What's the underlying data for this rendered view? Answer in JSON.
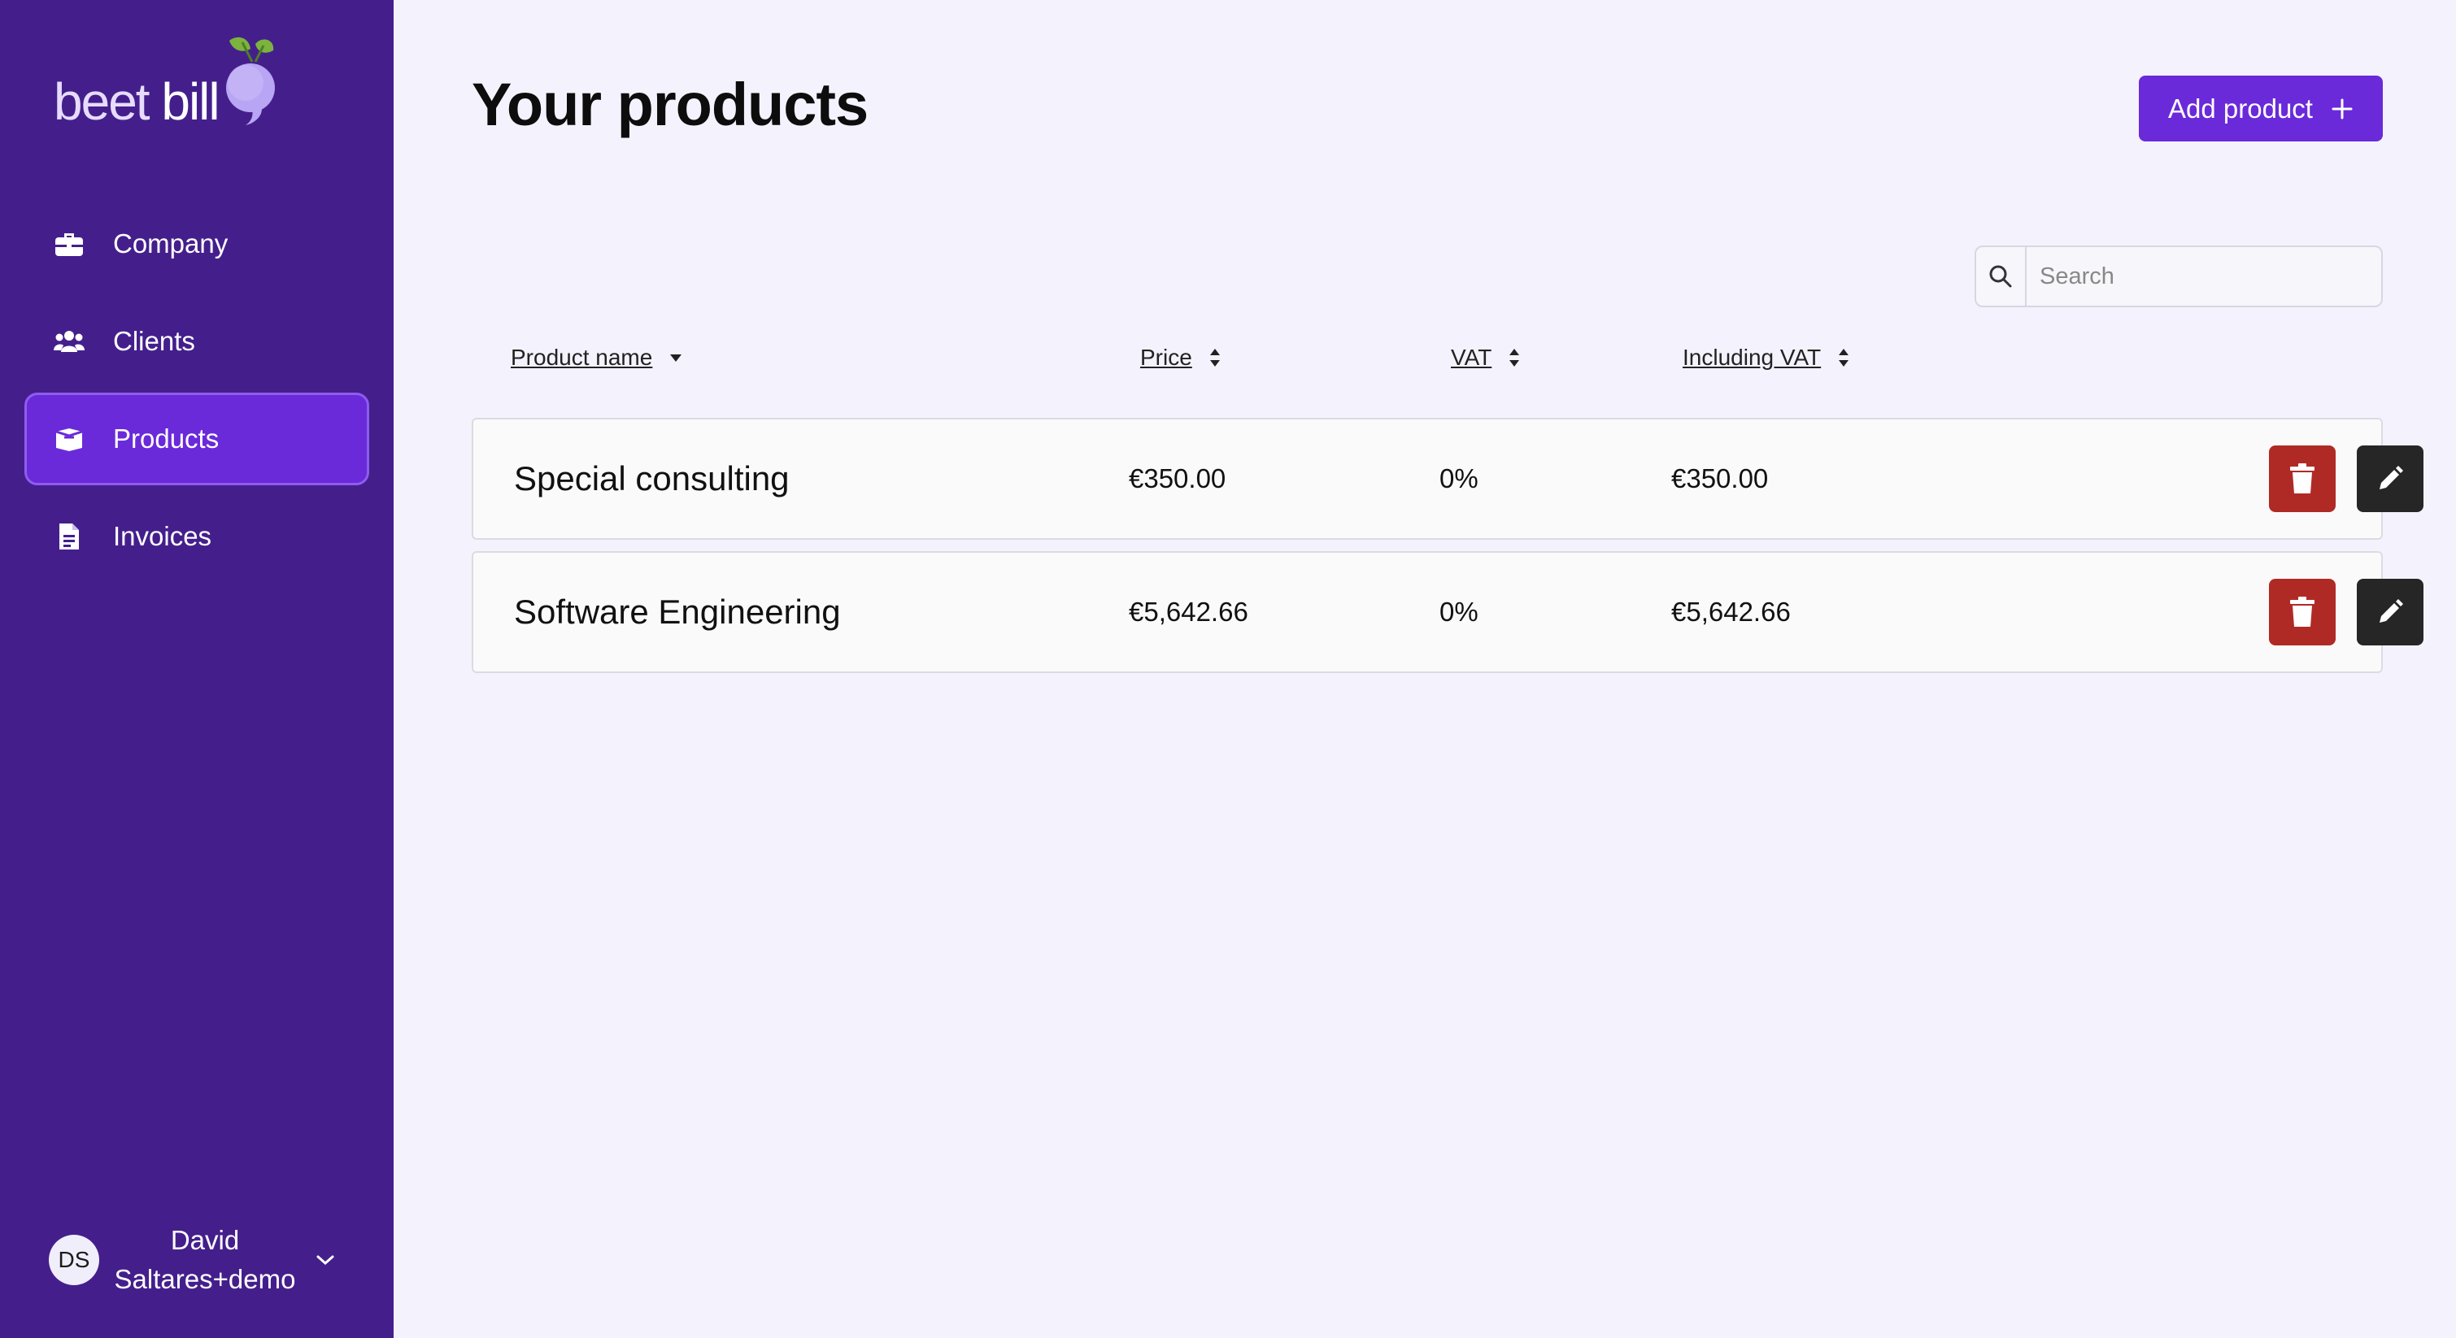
{
  "brand": {
    "logo_text_light": "beet ",
    "logo_text_bold": "bill"
  },
  "sidebar": {
    "items": [
      {
        "label": "Company",
        "icon": "briefcase-icon",
        "active": false
      },
      {
        "label": "Clients",
        "icon": "users-icon",
        "active": false
      },
      {
        "label": "Products",
        "icon": "box-icon",
        "active": true
      },
      {
        "label": "Invoices",
        "icon": "document-icon",
        "active": false
      }
    ],
    "user": {
      "initials": "DS",
      "name": "David Saltares+demo"
    }
  },
  "main": {
    "title": "Your products",
    "add_button_label": "Add product",
    "search": {
      "placeholder": "Search",
      "value": ""
    },
    "columns": [
      "Product name",
      "Price",
      "VAT",
      "Including VAT"
    ],
    "products": [
      {
        "name": "Special consulting",
        "price": "€350.00",
        "vat": "0%",
        "including_vat": "€350.00"
      },
      {
        "name": "Software Engineering",
        "price": "€5,642.66",
        "vat": "0%",
        "including_vat": "€5,642.66"
      }
    ]
  },
  "colors": {
    "sidebar_bg": "#441f8c",
    "accent": "#6a2ad9",
    "delete": "#b02a25",
    "edit": "#262626"
  }
}
